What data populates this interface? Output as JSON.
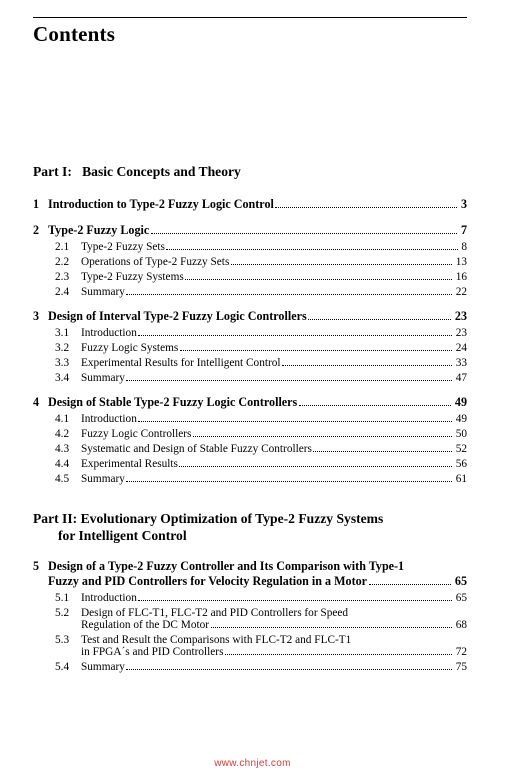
{
  "page": {
    "title": "Contents",
    "watermark": "www.chnjet.com"
  },
  "parts": [
    {
      "label": "Part I:",
      "title": "Basic Concepts and Theory"
    },
    {
      "label": "Part II:",
      "title_line1": "Evolutionary Optimization of Type-2 Fuzzy Systems",
      "title_line2": "for Intelligent Control"
    }
  ],
  "chapters": [
    {
      "num": "1",
      "title": "Introduction to Type-2 Fuzzy Logic Control",
      "page": "3",
      "sections": []
    },
    {
      "num": "2",
      "title": "Type-2 Fuzzy Logic",
      "page": "7",
      "sections": [
        {
          "num": "2.1",
          "title": "Type-2 Fuzzy Sets",
          "page": "8"
        },
        {
          "num": "2.2",
          "title": "Operations of Type-2 Fuzzy Sets",
          "page": "13"
        },
        {
          "num": "2.3",
          "title": "Type-2 Fuzzy Systems",
          "page": "16"
        },
        {
          "num": "2.4",
          "title": "Summary",
          "page": "22"
        }
      ]
    },
    {
      "num": "3",
      "title": "Design of Interval Type-2 Fuzzy Logic Controllers",
      "page": "23",
      "sections": [
        {
          "num": "3.1",
          "title": "Introduction",
          "page": "23"
        },
        {
          "num": "3.2",
          "title": "Fuzzy Logic Systems",
          "page": "24"
        },
        {
          "num": "3.3",
          "title": "Experimental Results for Intelligent Control",
          "page": "33"
        },
        {
          "num": "3.4",
          "title": "Summary",
          "page": "47"
        }
      ]
    },
    {
      "num": "4",
      "title": "Design of Stable Type-2 Fuzzy Logic Controllers",
      "page": "49",
      "sections": [
        {
          "num": "4.1",
          "title": "Introduction",
          "page": "49"
        },
        {
          "num": "4.2",
          "title": "Fuzzy Logic Controllers",
          "page": "50"
        },
        {
          "num": "4.3",
          "title": "Systematic and Design of Stable Fuzzy Controllers",
          "page": "52"
        },
        {
          "num": "4.4",
          "title": "Experimental Results",
          "page": "56"
        },
        {
          "num": "4.5",
          "title": "Summary",
          "page": "61"
        }
      ]
    },
    {
      "num": "5",
      "title_line1": "Design of a Type-2 Fuzzy Controller and Its Comparison with Type-1",
      "title_line2": "Fuzzy and PID Controllers for Velocity Regulation in a Motor",
      "page": "65",
      "sections": [
        {
          "num": "5.1",
          "title": "Introduction",
          "page": "65"
        },
        {
          "num": "5.2",
          "title_line1": "Design of FLC-T1, FLC-T2 and PID Controllers for Speed",
          "title_line2": "Regulation of the DC Motor",
          "page": "68"
        },
        {
          "num": "5.3",
          "title_line1": "Test and Result the Comparisons with FLC-T2 and  FLC-T1",
          "title_line2": "in FPGA´s and PID Controllers",
          "page": "72"
        },
        {
          "num": "5.4",
          "title": "Summary",
          "page": "75"
        }
      ]
    }
  ]
}
